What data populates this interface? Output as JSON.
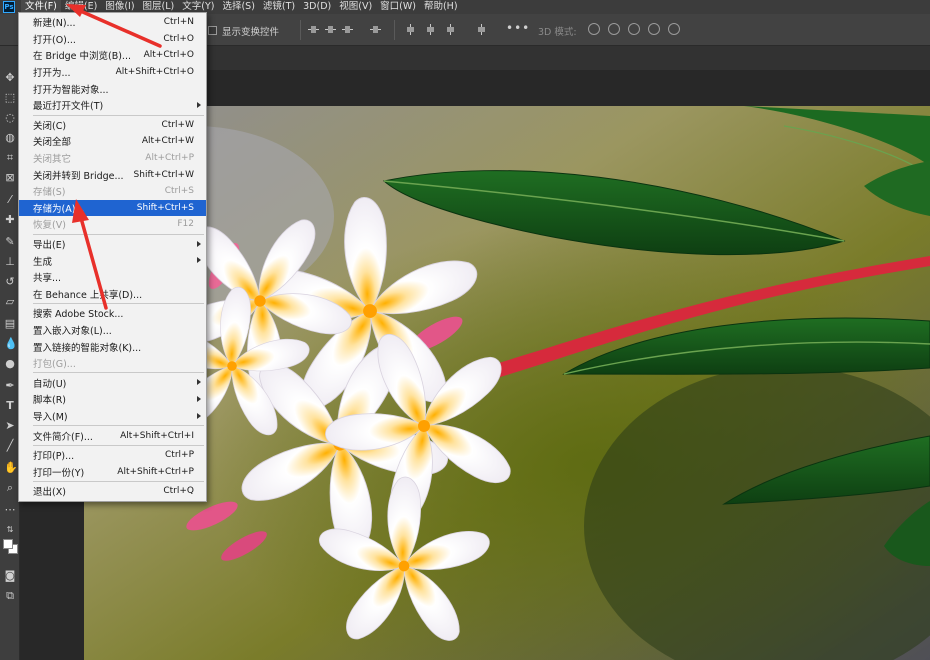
{
  "menubar": {
    "logo": "Ps",
    "items": [
      "文件(F)",
      "编辑(E)",
      "图像(I)",
      "图层(L)",
      "文字(Y)",
      "选择(S)",
      "滤镜(T)",
      "3D(D)",
      "视图(V)",
      "窗口(W)",
      "帮助(H)"
    ]
  },
  "options_bar": {
    "show_transform_label": "显示变换控件",
    "more_label": "•••",
    "mode_3d_label": "3D 模式:"
  },
  "file_menu": {
    "rows": [
      {
        "label": "新建(N)...",
        "shortcut": "Ctrl+N"
      },
      {
        "label": "打开(O)...",
        "shortcut": "Ctrl+O"
      },
      {
        "label": "在 Bridge 中浏览(B)...",
        "shortcut": "Alt+Ctrl+O"
      },
      {
        "label": "打开为...",
        "shortcut": "Alt+Shift+Ctrl+O"
      },
      {
        "label": "打开为智能对象...",
        "shortcut": ""
      },
      {
        "label": "最近打开文件(T)",
        "shortcut": ""
      },
      {
        "label": "关闭(C)",
        "shortcut": "Ctrl+W"
      },
      {
        "label": "关闭全部",
        "shortcut": "Alt+Ctrl+W"
      },
      {
        "label": "关闭其它",
        "shortcut": "Alt+Ctrl+P"
      },
      {
        "label": "关闭并转到 Bridge...",
        "shortcut": "Shift+Ctrl+W"
      },
      {
        "label": "存储(S)",
        "shortcut": "Ctrl+S"
      },
      {
        "label": "存储为(A)...",
        "shortcut": "Shift+Ctrl+S"
      },
      {
        "label": "恢复(V)",
        "shortcut": "F12"
      },
      {
        "label": "导出(E)",
        "shortcut": ""
      },
      {
        "label": "生成",
        "shortcut": ""
      },
      {
        "label": "共享...",
        "shortcut": ""
      },
      {
        "label": "在 Behance 上共享(D)...",
        "shortcut": ""
      },
      {
        "label": "搜索 Adobe Stock...",
        "shortcut": ""
      },
      {
        "label": "置入嵌入对象(L)...",
        "shortcut": ""
      },
      {
        "label": "置入链接的智能对象(K)...",
        "shortcut": ""
      },
      {
        "label": "打包(G)...",
        "shortcut": ""
      },
      {
        "label": "自动(U)",
        "shortcut": ""
      },
      {
        "label": "脚本(R)",
        "shortcut": ""
      },
      {
        "label": "导入(M)",
        "shortcut": ""
      },
      {
        "label": "文件简介(F)...",
        "shortcut": "Alt+Shift+Ctrl+I"
      },
      {
        "label": "打印(P)...",
        "shortcut": "Ctrl+P"
      },
      {
        "label": "打印一份(Y)",
        "shortcut": "Alt+Shift+Ctrl+P"
      },
      {
        "label": "退出(X)",
        "shortcut": "Ctrl+Q"
      }
    ]
  },
  "colors": {
    "menu_highlight": "#1f64d1",
    "annotation_red": "#e8302a",
    "flower_stem": "#d62a3c"
  }
}
